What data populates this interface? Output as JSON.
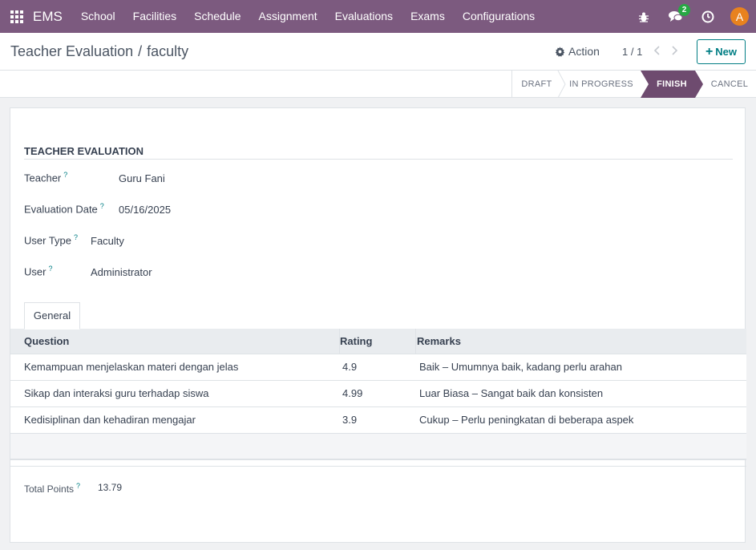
{
  "navbar": {
    "brand": "EMS",
    "menu": [
      "School",
      "Facilities",
      "Schedule",
      "Assignment",
      "Evaluations",
      "Exams",
      "Configurations"
    ],
    "messages_count": "2",
    "avatar_letter": "A",
    "colors": {
      "bar": "#7c5a7f",
      "badge": "#27a844",
      "avatar": "#e8821e"
    }
  },
  "control_panel": {
    "breadcrumb_parent": "Teacher Evaluation",
    "breadcrumb_separator": "/",
    "breadcrumb_current": "faculty",
    "action_label": "Action",
    "pager": "1 / 1",
    "new_label": "New"
  },
  "statusbar": {
    "stages": [
      "DRAFT",
      "IN PROGRESS",
      "FINISH",
      "CANCEL"
    ],
    "active": "FINISH",
    "active_color": "#6e4b6f"
  },
  "form": {
    "group_title": "TEACHER EVALUATION",
    "help_mark": "?",
    "fields": [
      {
        "label": "Teacher",
        "value": "Guru Fani"
      },
      {
        "label": "Evaluation Date",
        "value": "05/16/2025"
      },
      {
        "label": "User Type",
        "value": "Faculty"
      },
      {
        "label": "User",
        "value": "Administrator"
      }
    ],
    "tab": "General",
    "table": {
      "headers": [
        "Question",
        "Rating",
        "Remarks"
      ],
      "rows": [
        {
          "question": "Kemampuan menjelaskan materi dengan jelas",
          "rating": "4.9",
          "remarks": "Baik – Umumnya baik, kadang perlu arahan"
        },
        {
          "question": "Sikap dan interaksi guru terhadap siswa",
          "rating": "4.99",
          "remarks": "Luar Biasa – Sangat baik dan konsisten"
        },
        {
          "question": "Kedisiplinan dan kehadiran mengajar",
          "rating": "3.9",
          "remarks": "Cukup – Perlu peningkatan di beberapa aspek"
        }
      ]
    },
    "total_label": "Total Points",
    "total_value": "13.79"
  }
}
